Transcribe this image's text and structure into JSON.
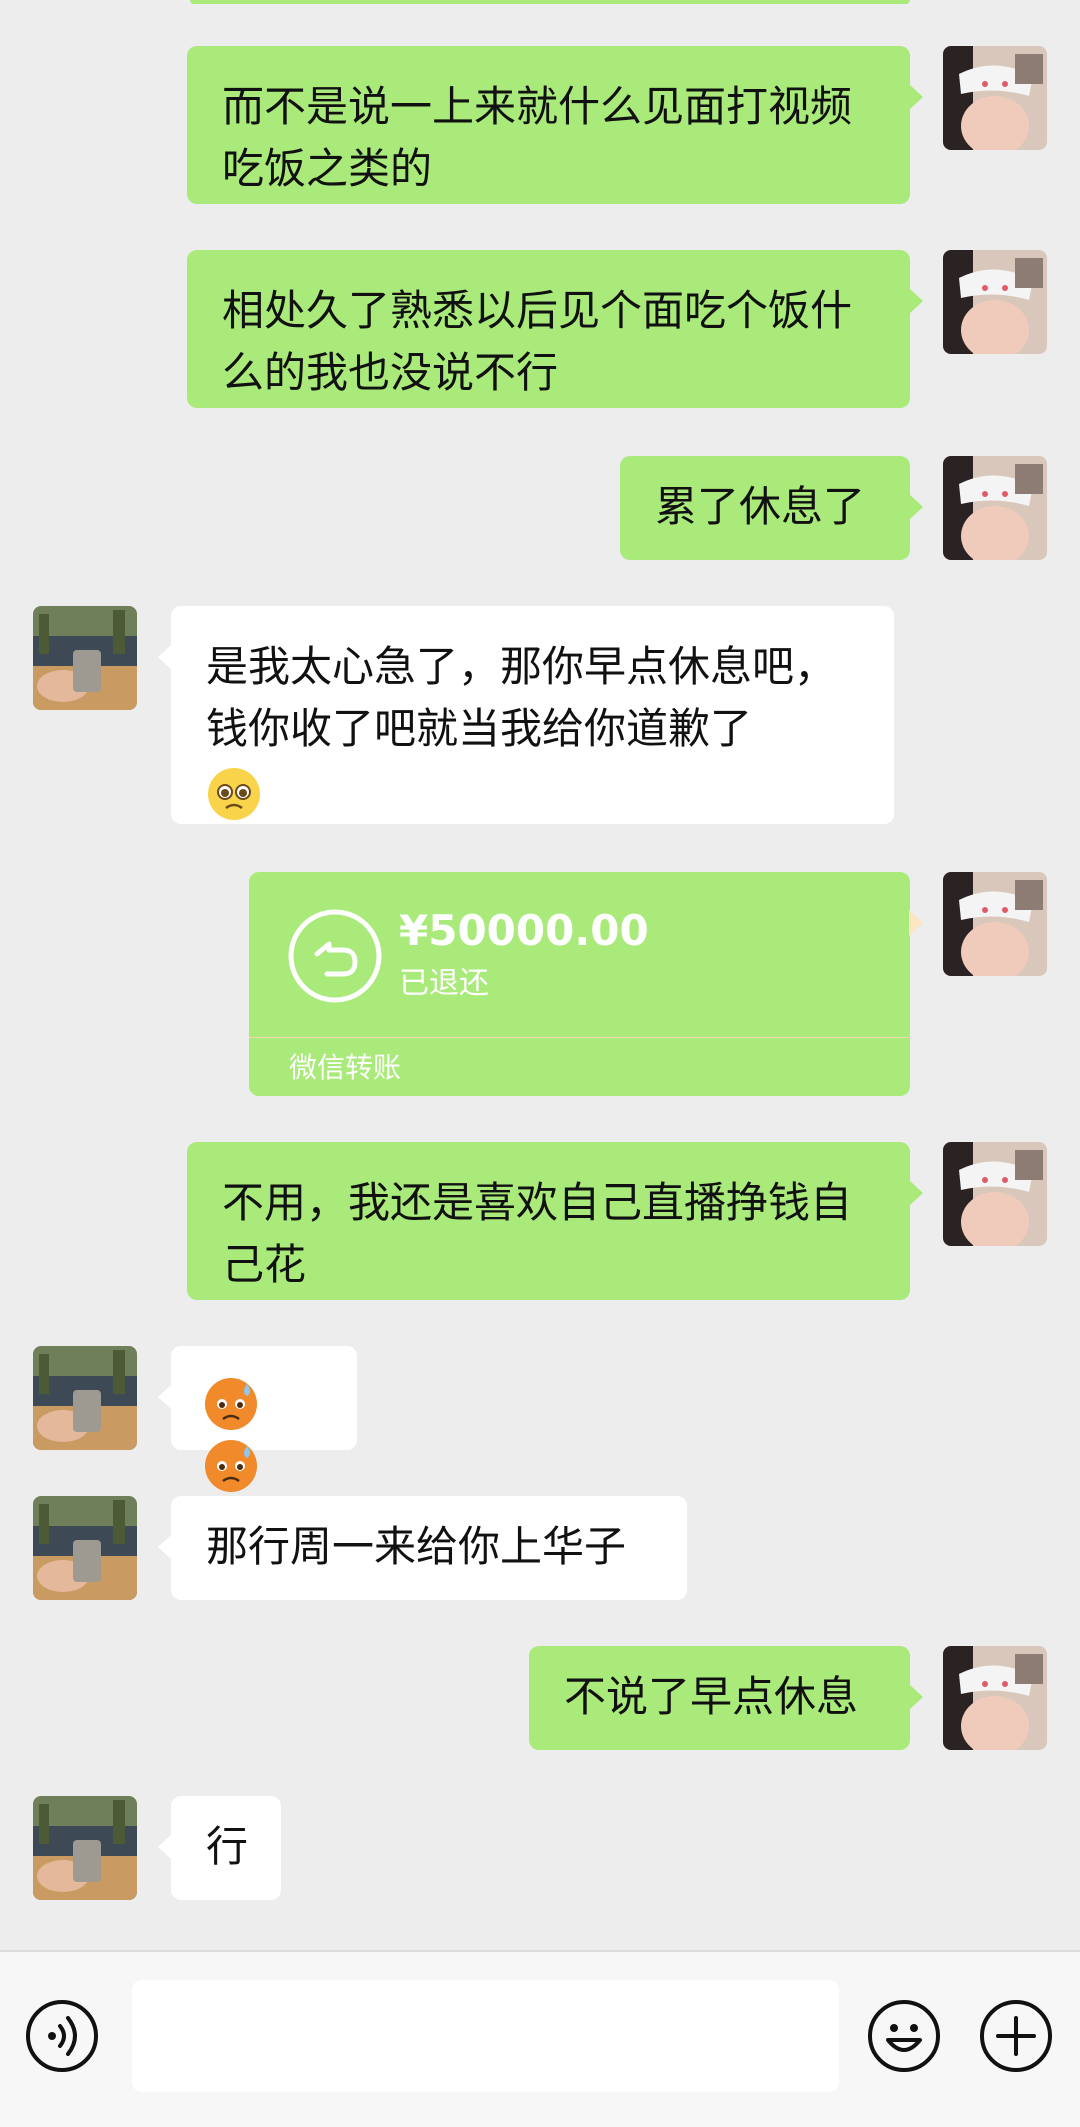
{
  "messages": [
    {
      "side": "me",
      "text": "而不是说一上来就什么见面打视频吃饭之类的"
    },
    {
      "side": "me",
      "text": "相处久了熟悉以后见个面吃个饭什么的我也没说不行"
    },
    {
      "side": "me",
      "text": "累了休息了"
    },
    {
      "side": "them",
      "text": "是我太心急了，那你早点休息吧，钱你收了吧就当我给你道歉了",
      "emoji": "pleading-face"
    },
    {
      "side": "me",
      "type": "transfer",
      "amount": "¥50000.00",
      "status": "已退还",
      "footer": "微信转账"
    },
    {
      "side": "me",
      "text": "不用，我还是喜欢自己直播挣钱自己花"
    },
    {
      "side": "them",
      "emoji_only": [
        "anxious-face-with-sweat",
        "anxious-face-with-sweat"
      ]
    },
    {
      "side": "them",
      "text": "那行周一来给你上华子"
    },
    {
      "side": "me",
      "text": "不说了早点休息"
    },
    {
      "side": "them",
      "text": "行"
    }
  ],
  "input": {
    "placeholder": ""
  },
  "icons": {
    "voice": "voice-icon",
    "emoji": "emoji-icon",
    "plus": "plus-icon"
  },
  "colors": {
    "background": "#ededed",
    "my_bubble": "#a9ea7a",
    "their_bubble": "#ffffff",
    "transfer_card": "#fbe5c3"
  }
}
